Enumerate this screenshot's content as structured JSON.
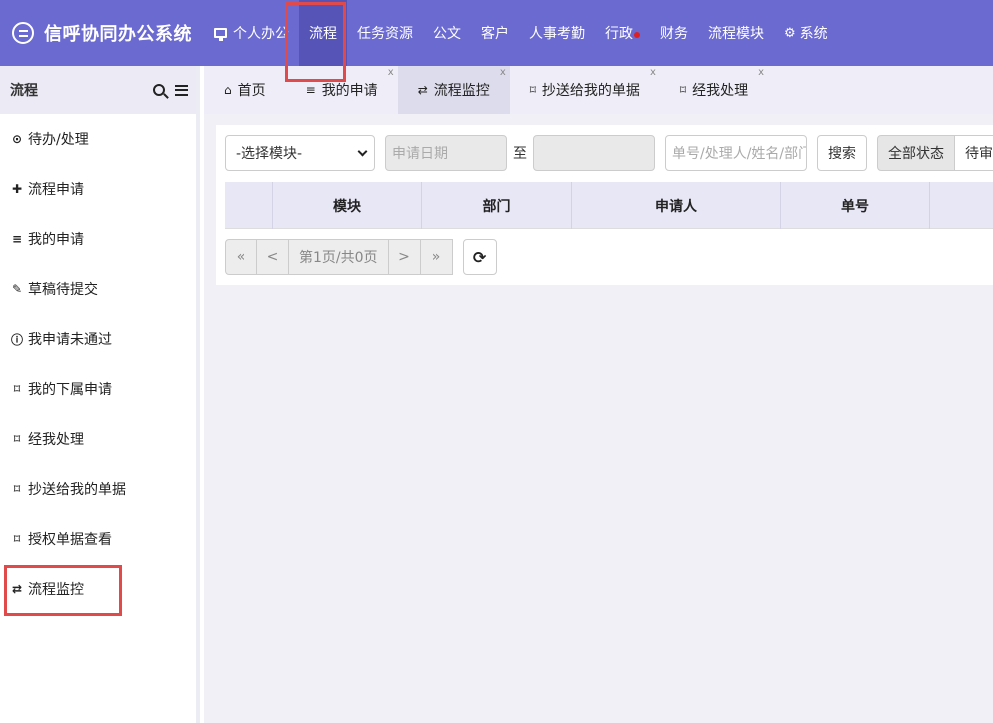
{
  "app": {
    "title": "信呼协同办公系统",
    "logo_icon": "chat-bubble-icon"
  },
  "topnav": [
    {
      "label": "个人办公",
      "icon": "monitor-icon",
      "active": false
    },
    {
      "label": "流程",
      "active": true
    },
    {
      "label": "任务资源",
      "active": false
    },
    {
      "label": "公文",
      "active": false
    },
    {
      "label": "客户",
      "active": false
    },
    {
      "label": "人事考勤",
      "active": false
    },
    {
      "label": "行政",
      "badge": "red-dot",
      "active": false
    },
    {
      "label": "财务",
      "active": false
    },
    {
      "label": "流程模块",
      "active": false
    },
    {
      "label": "系统",
      "icon": "gear-icon",
      "active": false
    }
  ],
  "sidebar": {
    "title": "流程",
    "items": [
      {
        "label": "待办/处理",
        "icon": "clock-icon"
      },
      {
        "label": "流程申请",
        "icon": "plus-icon"
      },
      {
        "label": "我的申请",
        "icon": "align-left-icon"
      },
      {
        "label": "草稿待提交",
        "icon": "edit-icon"
      },
      {
        "label": "我申请未通过",
        "icon": "info-circle-icon"
      },
      {
        "label": "我的下属申请",
        "icon": "bookmark-icon"
      },
      {
        "label": "经我处理",
        "icon": "bookmark-icon"
      },
      {
        "label": "抄送给我的单据",
        "icon": "bookmark-icon"
      },
      {
        "label": "授权单据查看",
        "icon": "bookmark-icon"
      },
      {
        "label": "流程监控",
        "icon": "retweet-icon"
      }
    ]
  },
  "tabs": [
    {
      "label": "首页",
      "icon": "home-icon",
      "closable": false
    },
    {
      "label": "我的申请",
      "icon": "align-left-icon",
      "closable": true
    },
    {
      "label": "流程监控",
      "icon": "retweet-icon",
      "closable": true,
      "active": true
    },
    {
      "label": "抄送给我的单据",
      "icon": "bookmark-icon",
      "closable": true
    },
    {
      "label": "经我处理",
      "icon": "bookmark-icon",
      "closable": true
    }
  ],
  "tab_close_label": "x",
  "filters": {
    "module_select": "-选择模块-",
    "date_placeholder": "申请日期",
    "to_label": "至",
    "keyword_placeholder": "单号/处理人/姓名/部门",
    "search_button": "搜索",
    "status_all": "全部状态",
    "status_pending": "待审核"
  },
  "table": {
    "columns": [
      "",
      "模块",
      "部门",
      "申请人",
      "单号",
      ""
    ]
  },
  "pager": {
    "first": "«",
    "prev": "<",
    "info": "第1页/共0页",
    "next": ">",
    "last": "»"
  },
  "colors": {
    "topbar": "#6b6ad0",
    "topbar_active": "#5655b7",
    "highlight": "#e04a4a",
    "header_row": "#e8e7f6"
  }
}
